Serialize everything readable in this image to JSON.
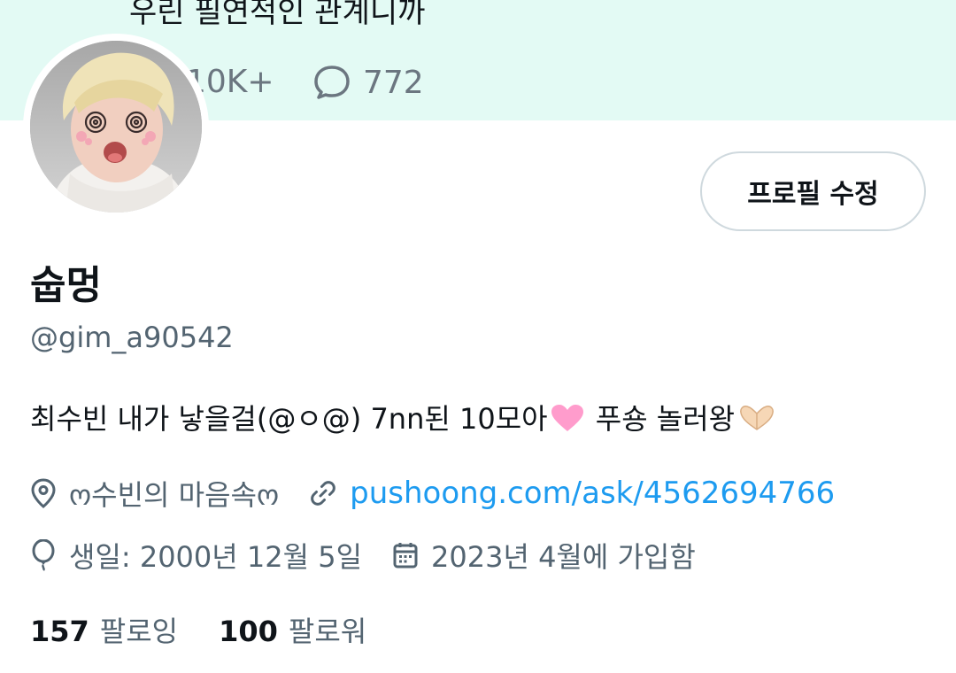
{
  "banner": {
    "tweet_text": "우린 필연적인 관계니까",
    "likes": "10K+",
    "replies": "772"
  },
  "profile": {
    "edit_button": "프로필 수정",
    "display_name": "숩멍",
    "handle": "@gim_a90542",
    "bio_text": "최수빈 내가 낳을걸(@ㅇ@) 7nn된 10모아",
    "bio_tail": " 푸숑 놀러왕",
    "location": "ო수빈의 마음속ო",
    "link": "pushoong.com/ask/4562694766",
    "birthday": "생일: 2000년 12월 5일",
    "joined": "2023년 4월에 가입함"
  },
  "follow": {
    "following_count": "157",
    "following_label": "팔로잉",
    "followers_count": "100",
    "followers_label": "팔로워"
  },
  "icons": {
    "location": "location-pin-icon",
    "link": "link-icon",
    "birthday": "balloon-icon",
    "joined": "calendar-icon",
    "replies": "reply-bubble-icon"
  },
  "colors": {
    "banner_bg": "#e3faf4",
    "link": "#1d9bf0",
    "secondary_text": "#536471"
  }
}
